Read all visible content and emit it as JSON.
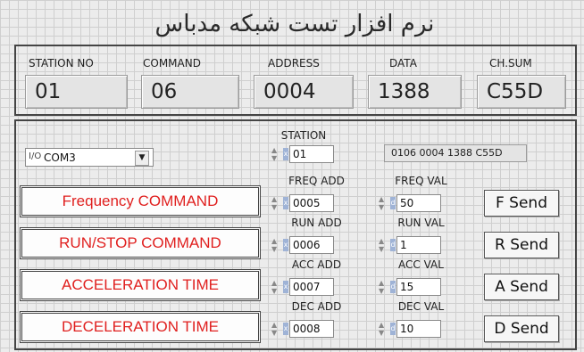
{
  "app": {
    "title": "نرم افزار تست شبکه مدباس"
  },
  "header": {
    "labels": [
      "STATION NO",
      "COMMAND",
      "ADDRESS",
      "DATA",
      "CH.SUM"
    ],
    "values": [
      "01",
      "06",
      "0004",
      "1388",
      "C55D"
    ]
  },
  "port": {
    "prefix": "I/O",
    "value": "COM3"
  },
  "station": {
    "label": "STATION",
    "value": "01"
  },
  "packet_display": "0106 0004 1388 C55D",
  "commands": [
    {
      "button": "Frequency COMMAND",
      "addr_label": "FREQ ADD",
      "addr_value": "0005",
      "val_label": "FREQ VAL",
      "val_value": "50",
      "send": "F Send"
    },
    {
      "button": "RUN/STOP COMMAND",
      "addr_label": "RUN ADD",
      "addr_value": "0006",
      "val_label": "RUN VAL",
      "val_value": "1",
      "send": "R Send"
    },
    {
      "button": "ACCELERATION TIME",
      "addr_label": "ACC ADD",
      "addr_value": "0007",
      "val_label": "ACC VAL",
      "val_value": "15",
      "send": "A Send"
    },
    {
      "button": "DECELERATION TIME",
      "addr_label": "DEC ADD",
      "addr_value": "0008",
      "val_label": "DEC VAL",
      "val_value": "10",
      "send": "D Send"
    }
  ],
  "colors": {
    "command_text": "#e0201f",
    "radix_indicator": "#9fb3d6"
  }
}
